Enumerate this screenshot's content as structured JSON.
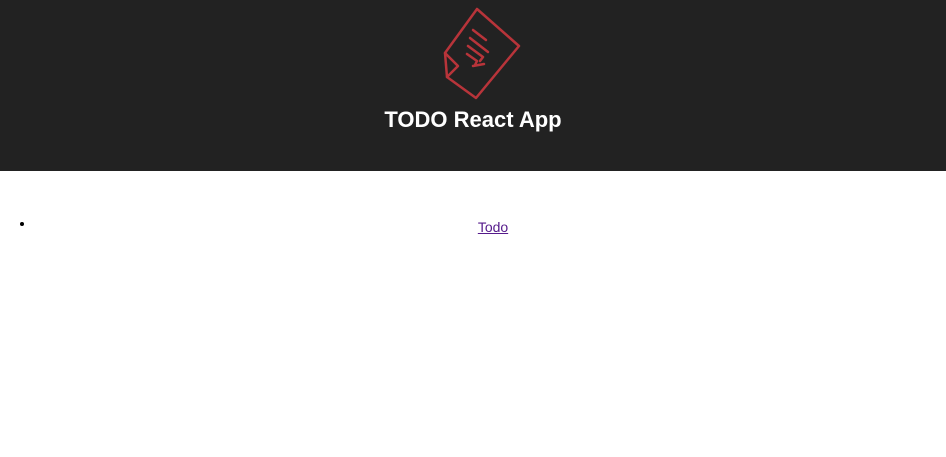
{
  "header": {
    "logo_icon": "todo-document-icon",
    "logo_color": "#b8343a",
    "title": "TODO React App",
    "background": "#222222"
  },
  "nav": {
    "items": [
      {
        "label": "Todo",
        "color": "#551a8b"
      }
    ]
  }
}
